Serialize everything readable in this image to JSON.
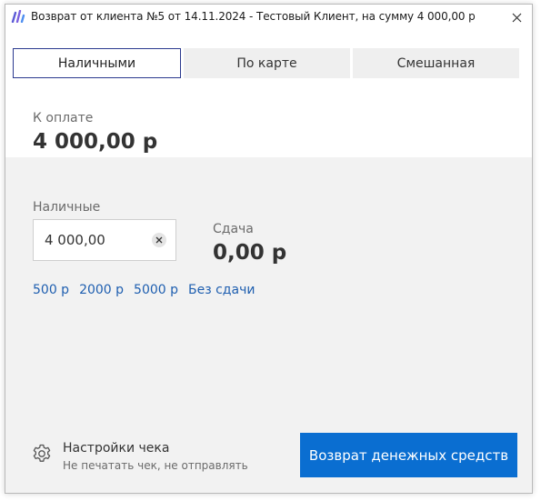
{
  "window": {
    "title": "Возврат от клиента №5 от 14.11.2024 - Тестовый Клиент, на сумму 4 000,00 р",
    "close_icon": "close-icon",
    "app_icon": "app-logo-icon"
  },
  "tabs": [
    {
      "label": "Наличными",
      "active": true
    },
    {
      "label": "По карте",
      "active": false
    },
    {
      "label": "Смешанная",
      "active": false
    }
  ],
  "payment": {
    "amount_label": "К оплате",
    "amount_value": "4 000,00 р"
  },
  "cash": {
    "label": "Наличные",
    "value": "4 000,00",
    "change_label": "Сдача",
    "change_value": "0,00 р",
    "quick_options": [
      "500 р",
      "2000 р",
      "5000 р",
      "Без сдачи"
    ]
  },
  "receipt": {
    "title": "Настройки чека",
    "subtitle": "Не печатать чек, не отправлять",
    "icon": "gear-icon"
  },
  "actions": {
    "refund_label": "Возврат денежных средств"
  },
  "colors": {
    "accent": "#0A6ED1",
    "link": "#1F5FB0",
    "active_tab_border": "#2B3A8F",
    "grey_background": "#F2F2F2"
  }
}
